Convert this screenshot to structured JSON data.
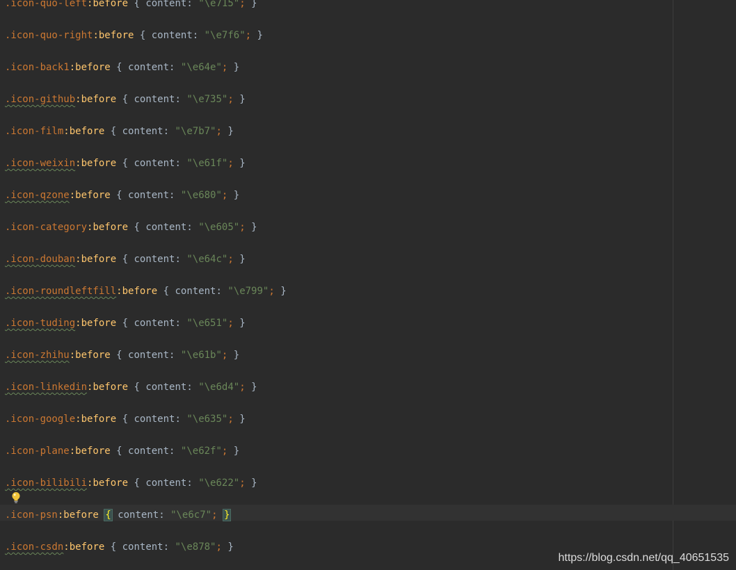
{
  "editor": {
    "lines": [
      {
        "selector": ".icon-quo-left",
        "pseudo": ":before",
        "open": " { ",
        "prop": "content",
        "colon": ": ",
        "value": "\"\\e715\"",
        "semi": ";",
        "close": " }",
        "squiggle": false
      },
      {
        "selector": ".icon-quo-right",
        "pseudo": ":before",
        "open": " { ",
        "prop": "content",
        "colon": ": ",
        "value": "\"\\e7f6\"",
        "semi": ";",
        "close": " }",
        "squiggle": false
      },
      {
        "selector": ".icon-back1",
        "pseudo": ":before",
        "open": " { ",
        "prop": "content",
        "colon": ": ",
        "value": "\"\\e64e\"",
        "semi": ";",
        "close": " }",
        "squiggle": false
      },
      {
        "selector": ".icon-github",
        "pseudo": ":before",
        "open": " { ",
        "prop": "content",
        "colon": ": ",
        "value": "\"\\e735\"",
        "semi": ";",
        "close": " }",
        "squiggle": true
      },
      {
        "selector": ".icon-film",
        "pseudo": ":before",
        "open": " { ",
        "prop": "content",
        "colon": ": ",
        "value": "\"\\e7b7\"",
        "semi": ";",
        "close": " }",
        "squiggle": false
      },
      {
        "selector": ".icon-weixin",
        "pseudo": ":before",
        "open": " { ",
        "prop": "content",
        "colon": ": ",
        "value": "\"\\e61f\"",
        "semi": ";",
        "close": " }",
        "squiggle": true
      },
      {
        "selector": ".icon-qzone",
        "pseudo": ":before",
        "open": " { ",
        "prop": "content",
        "colon": ": ",
        "value": "\"\\e680\"",
        "semi": ";",
        "close": " }",
        "squiggle": true
      },
      {
        "selector": ".icon-category",
        "pseudo": ":before",
        "open": " { ",
        "prop": "content",
        "colon": ": ",
        "value": "\"\\e605\"",
        "semi": ";",
        "close": " }",
        "squiggle": false
      },
      {
        "selector": ".icon-douban",
        "pseudo": ":before",
        "open": " { ",
        "prop": "content",
        "colon": ": ",
        "value": "\"\\e64c\"",
        "semi": ";",
        "close": " }",
        "squiggle": true
      },
      {
        "selector": ".icon-roundleftfill",
        "pseudo": ":before",
        "open": " { ",
        "prop": "content",
        "colon": ": ",
        "value": "\"\\e799\"",
        "semi": ";",
        "close": " }",
        "squiggle": true
      },
      {
        "selector": ".icon-tuding",
        "pseudo": ":before",
        "open": " { ",
        "prop": "content",
        "colon": ": ",
        "value": "\"\\e651\"",
        "semi": ";",
        "close": " }",
        "squiggle": true
      },
      {
        "selector": ".icon-zhihu",
        "pseudo": ":before",
        "open": " { ",
        "prop": "content",
        "colon": ": ",
        "value": "\"\\e61b\"",
        "semi": ";",
        "close": " }",
        "squiggle": true
      },
      {
        "selector": ".icon-linkedin",
        "pseudo": ":before",
        "open": " { ",
        "prop": "content",
        "colon": ": ",
        "value": "\"\\e6d4\"",
        "semi": ";",
        "close": " }",
        "squiggle": true
      },
      {
        "selector": ".icon-google",
        "pseudo": ":before",
        "open": " { ",
        "prop": "content",
        "colon": ": ",
        "value": "\"\\e635\"",
        "semi": ";",
        "close": " }",
        "squiggle": false
      },
      {
        "selector": ".icon-plane",
        "pseudo": ":before",
        "open": " { ",
        "prop": "content",
        "colon": ": ",
        "value": "\"\\e62f\"",
        "semi": ";",
        "close": " }",
        "squiggle": false
      },
      {
        "selector": ".icon-bilibili",
        "pseudo": ":before",
        "open": " { ",
        "prop": "content",
        "colon": ": ",
        "value": "\"\\e622\"",
        "semi": ";",
        "close": " }",
        "squiggle": true
      },
      {
        "selector": ".icon-psn",
        "pseudo": ":before",
        "open": " ",
        "openBrace": "{",
        "prop": "content",
        "colon": ": ",
        "value": "\"\\e6c7\"",
        "semi": ";",
        "close": " ",
        "closeBrace": "}",
        "squiggle": false,
        "highlight": true
      },
      {
        "selector": ".icon-csdn",
        "pseudo": ":before",
        "open": " { ",
        "prop": "content",
        "colon": ": ",
        "value": "\"\\e878\"",
        "semi": ";",
        "close": " }",
        "squiggle": true
      }
    ]
  },
  "intention_icon": "lightbulb-icon",
  "watermark": "https://blog.csdn.net/qq_40651535",
  "colors": {
    "background": "#2b2b2b",
    "selector": "#cc7832",
    "pseudo": "#ffc66d",
    "string": "#6a8759",
    "text": "#a9b7c6"
  }
}
